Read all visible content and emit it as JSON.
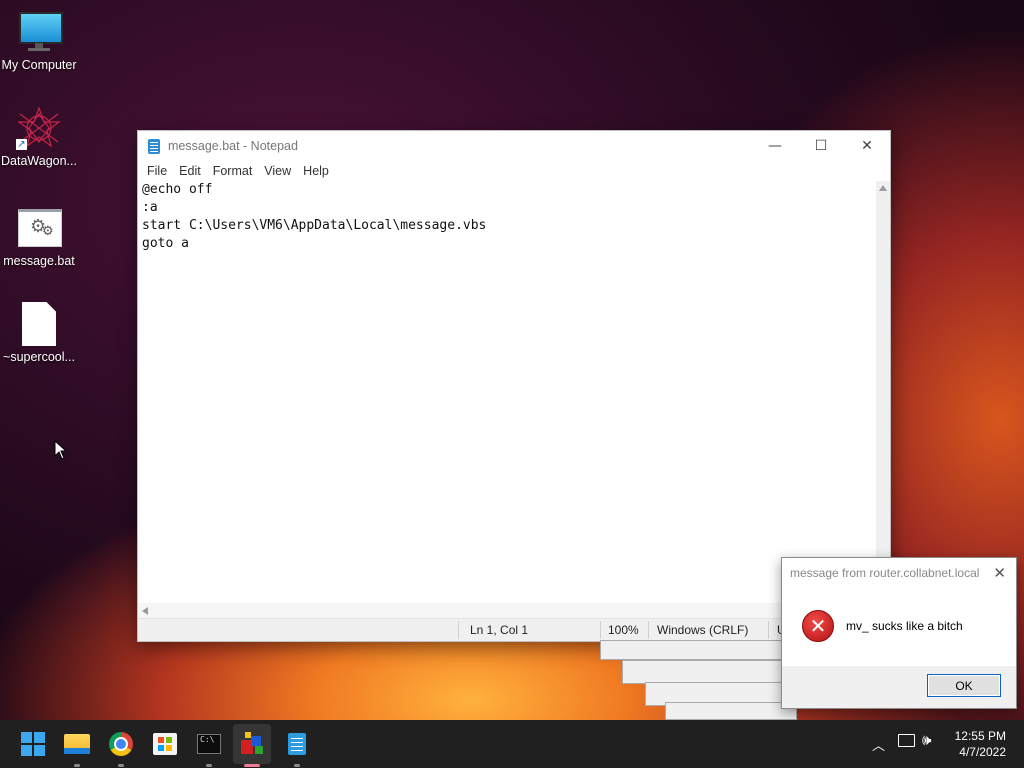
{
  "desktop": {
    "icons": [
      {
        "label": "My Computer",
        "icon": "monitor-icon"
      },
      {
        "label": "DataWagon...",
        "icon": "datawagon-icon"
      },
      {
        "label": "message.bat",
        "icon": "batch-file-icon"
      },
      {
        "label": "~supercool...",
        "icon": "blank-file-icon"
      }
    ]
  },
  "notepad": {
    "title": "message.bat - Notepad",
    "menu": [
      "File",
      "Edit",
      "Format",
      "View",
      "Help"
    ],
    "lines": [
      "@echo off",
      ":a",
      "start C:\\Users\\VM6\\AppData\\Local\\message.vbs",
      "goto a"
    ],
    "status": {
      "position": "Ln 1, Col 1",
      "zoom": "100%",
      "line_endings": "Windows (CRLF)",
      "encoding_partial": "U"
    }
  },
  "msgbox": {
    "title": "message from router.collabnet.local",
    "text": "mv_ sucks like a bitch",
    "ok_label": "OK",
    "icon": "error-icon"
  },
  "taskbar": {
    "apps": [
      "start-icon",
      "file-explorer-icon",
      "chrome-icon",
      "store-icon",
      "terminal-icon",
      "active-app-icon",
      "notepad-icon"
    ],
    "time": "12:55 PM",
    "date": "4/7/2022"
  }
}
